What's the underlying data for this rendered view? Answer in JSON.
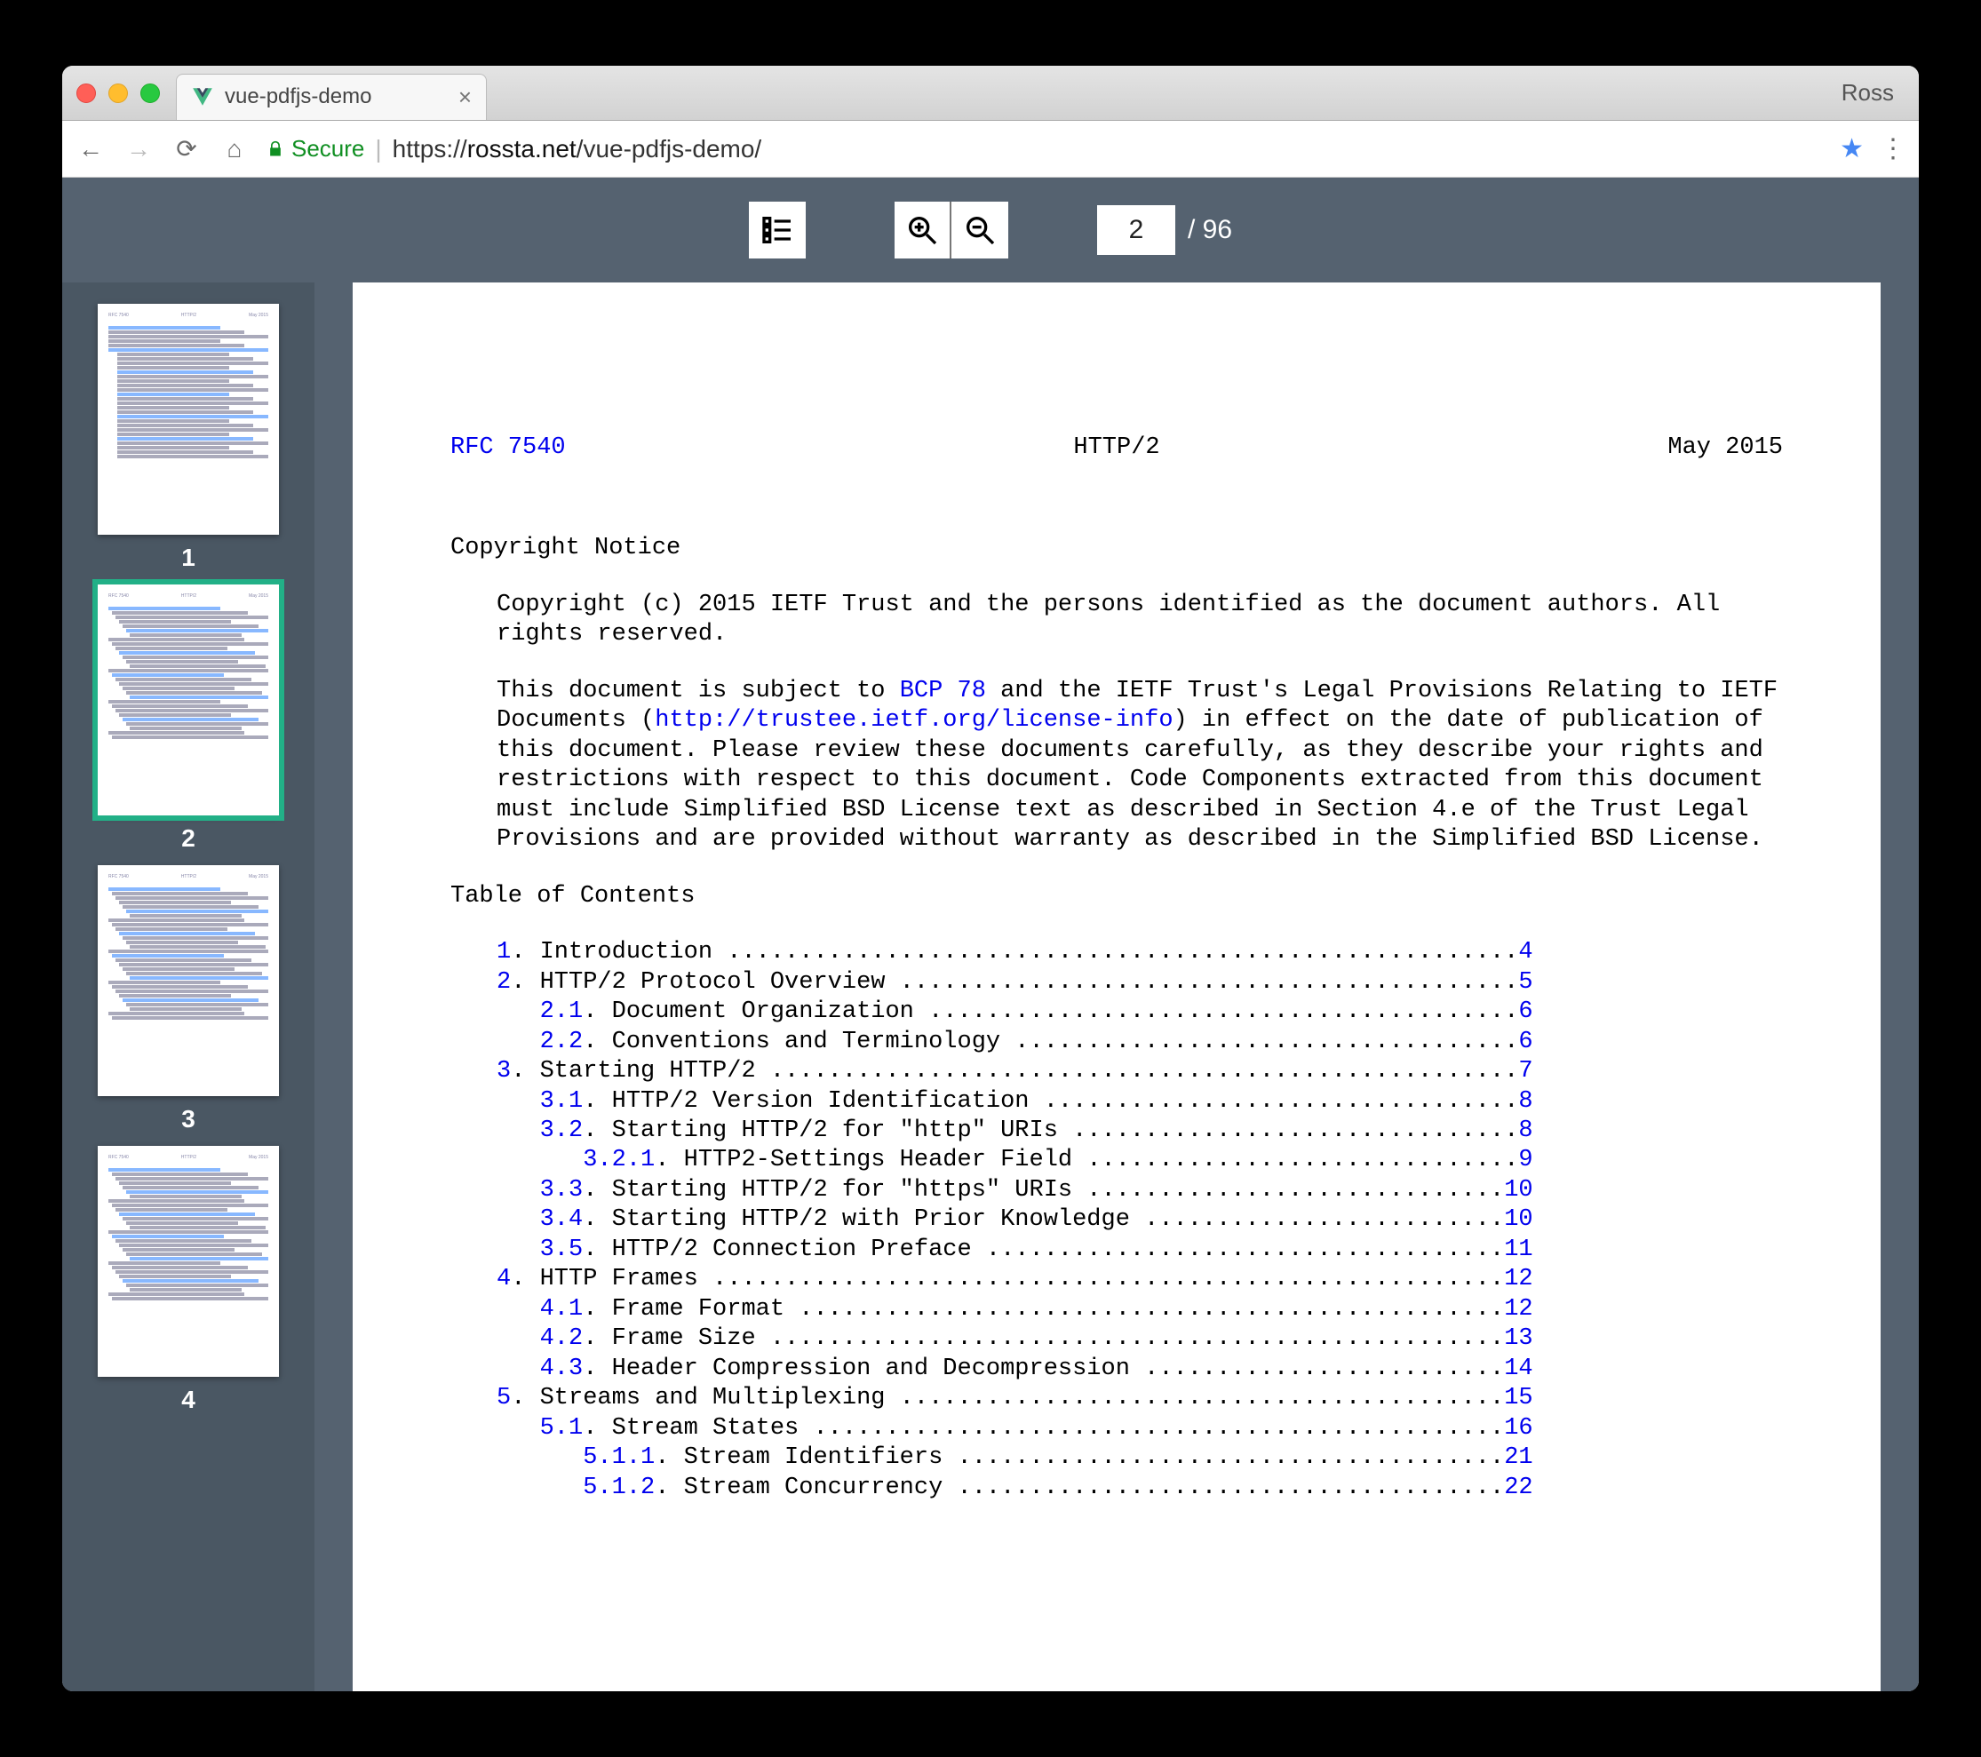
{
  "browser": {
    "user_label": "Ross",
    "tab_title": "vue-pdfjs-demo",
    "secure_label": "Secure",
    "url_scheme": "https://",
    "url_host": "rossta.net",
    "url_path": "/vue-pdfjs-demo/"
  },
  "viewer": {
    "current_page_value": "2",
    "total_pages_label": "/ 96",
    "thumbnails": [
      {
        "label": "1",
        "active": false
      },
      {
        "label": "2",
        "active": true
      },
      {
        "label": "3",
        "active": false
      },
      {
        "label": "4",
        "active": false
      }
    ]
  },
  "doc": {
    "rfc_label": "RFC 7540",
    "title": "HTTP/2",
    "date": "May 2015",
    "copyright_heading": "Copyright Notice",
    "copyright_p1": "Copyright (c) 2015 IETF Trust and the persons identified as the document authors.  All rights reserved.",
    "copyright_p2a": "This document is subject to ",
    "bcp_link": "BCP 78",
    "copyright_p2b": " and the IETF Trust's Legal Provisions Relating to IETF Documents (",
    "license_link": "http://trustee.ietf.org/license-info",
    "copyright_p2c": ") in effect on the date of publication of this document.  Please review these documents carefully, as they describe your rights and restrictions with respect to this document.  Code Components extracted from this document must include Simplified BSD License text as described in Section 4.e of the Trust Legal Provisions and are provided without warranty as described in the Simplified BSD License.",
    "toc_heading": "Table of Contents",
    "toc": [
      {
        "n": "1",
        "t": "Introduction",
        "p": "4",
        "ind": 0
      },
      {
        "n": "2",
        "t": "HTTP/2 Protocol Overview",
        "p": "5",
        "ind": 0
      },
      {
        "n": "2.1",
        "t": "Document Organization",
        "p": "6",
        "ind": 1
      },
      {
        "n": "2.2",
        "t": "Conventions and Terminology",
        "p": "6",
        "ind": 1
      },
      {
        "n": "3",
        "t": "Starting HTTP/2",
        "p": "7",
        "ind": 0
      },
      {
        "n": "3.1",
        "t": "HTTP/2 Version Identification",
        "p": "8",
        "ind": 1
      },
      {
        "n": "3.2",
        "t": "Starting HTTP/2 for \"http\" URIs",
        "p": "8",
        "ind": 1
      },
      {
        "n": "3.2.1",
        "t": "HTTP2-Settings Header Field",
        "p": "9",
        "ind": 2
      },
      {
        "n": "3.3",
        "t": "Starting HTTP/2 for \"https\" URIs",
        "p": "10",
        "ind": 1
      },
      {
        "n": "3.4",
        "t": "Starting HTTP/2 with Prior Knowledge",
        "p": "10",
        "ind": 1
      },
      {
        "n": "3.5",
        "t": "HTTP/2 Connection Preface",
        "p": "11",
        "ind": 1
      },
      {
        "n": "4",
        "t": "HTTP Frames",
        "p": "12",
        "ind": 0
      },
      {
        "n": "4.1",
        "t": "Frame Format",
        "p": "12",
        "ind": 1
      },
      {
        "n": "4.2",
        "t": "Frame Size",
        "p": "13",
        "ind": 1
      },
      {
        "n": "4.3",
        "t": "Header Compression and Decompression",
        "p": "14",
        "ind": 1
      },
      {
        "n": "5",
        "t": "Streams and Multiplexing",
        "p": "15",
        "ind": 0
      },
      {
        "n": "5.1",
        "t": "Stream States",
        "p": "16",
        "ind": 1
      },
      {
        "n": "5.1.1",
        "t": "Stream Identifiers",
        "p": "21",
        "ind": 2
      },
      {
        "n": "5.1.2",
        "t": "Stream Concurrency",
        "p": "22",
        "ind": 2
      }
    ]
  }
}
